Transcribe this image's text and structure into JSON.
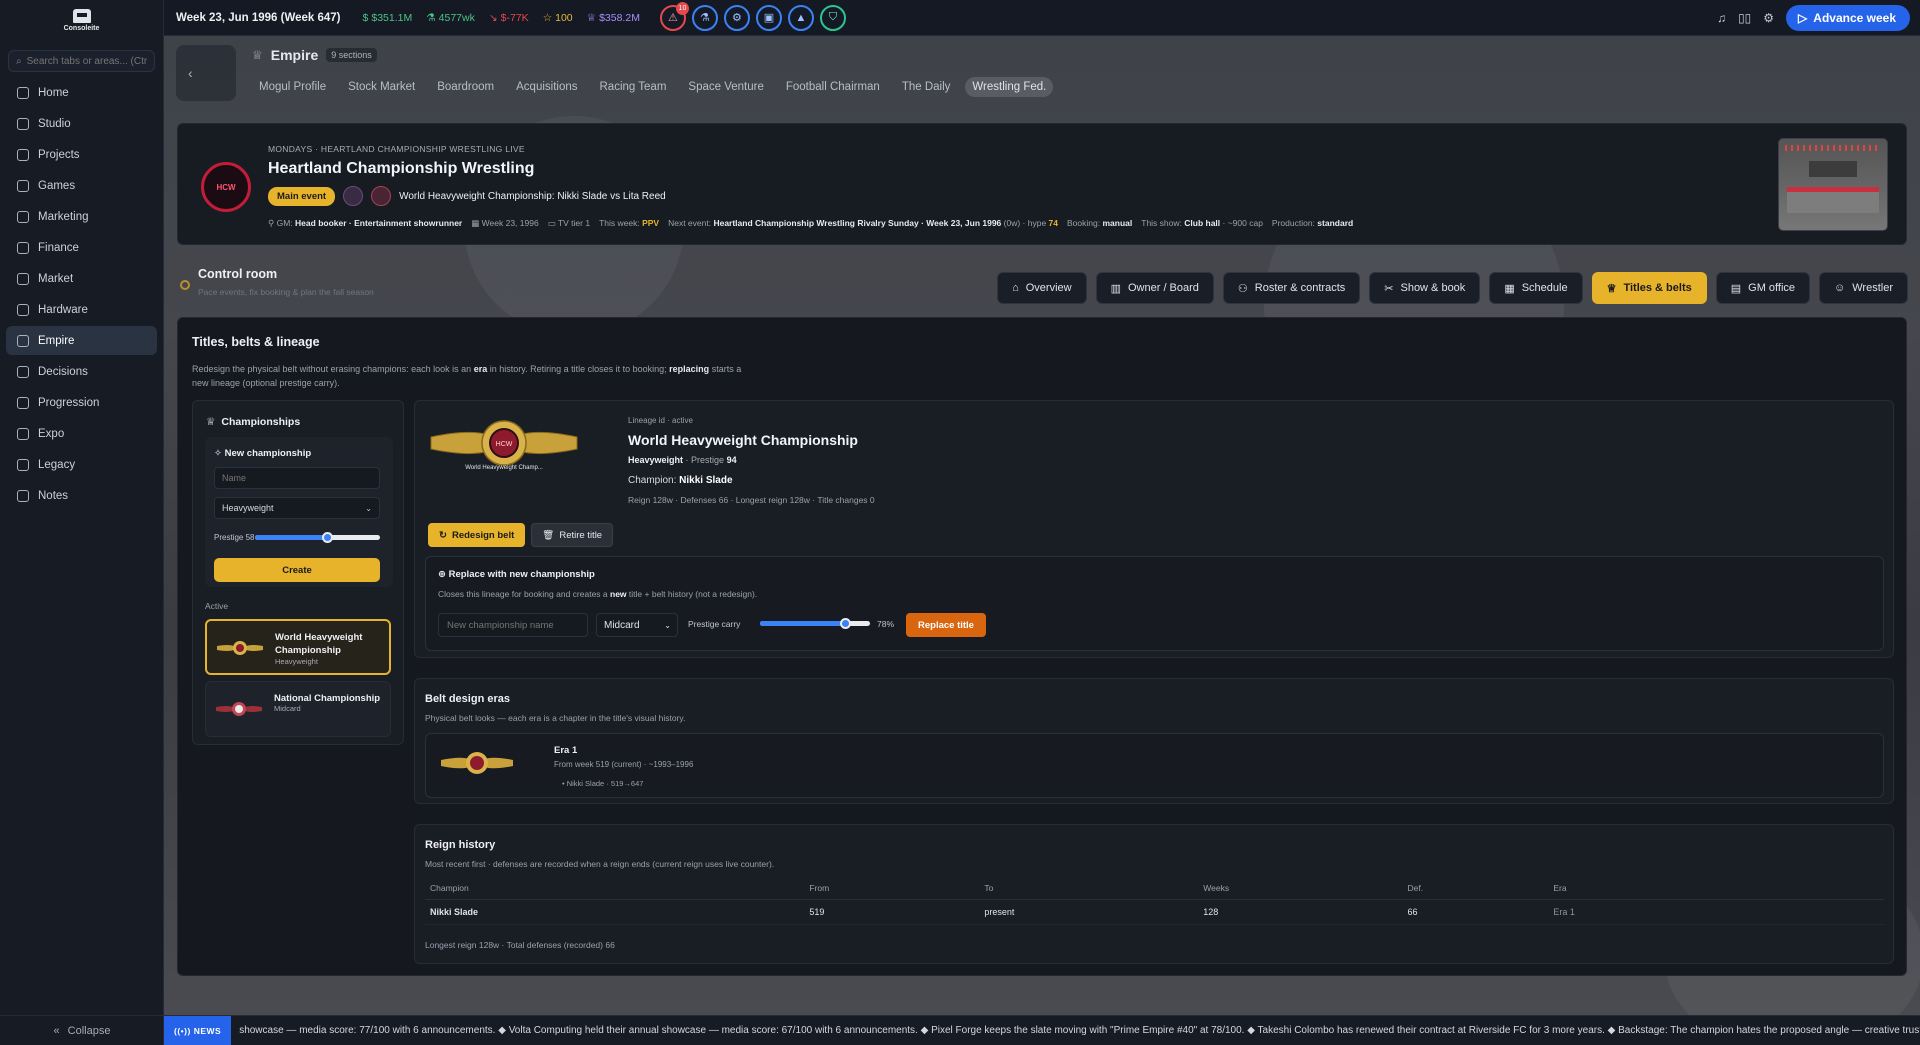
{
  "app": {
    "logo_text": "Consoleite"
  },
  "sidebar": {
    "search_placeholder": "Search tabs or areas... (Ctrl+K)",
    "items": [
      {
        "label": "Home",
        "icon": "grid-icon"
      },
      {
        "label": "Studio",
        "icon": "building-icon"
      },
      {
        "label": "Projects",
        "icon": "folder-icon"
      },
      {
        "label": "Games",
        "icon": "gamepad-icon"
      },
      {
        "label": "Marketing",
        "icon": "megaphone-icon"
      },
      {
        "label": "Finance",
        "icon": "bank-icon"
      },
      {
        "label": "Market",
        "icon": "globe-icon"
      },
      {
        "label": "Hardware",
        "icon": "chip-icon"
      },
      {
        "label": "Empire",
        "icon": "crown-icon",
        "active": true
      },
      {
        "label": "Decisions",
        "icon": "warning-icon"
      },
      {
        "label": "Progression",
        "icon": "flask-icon"
      },
      {
        "label": "Expo",
        "icon": "monitor-icon"
      },
      {
        "label": "Legacy",
        "icon": "book-icon"
      },
      {
        "label": "Notes",
        "icon": "note-icon"
      }
    ],
    "collapse_label": "Collapse"
  },
  "topbar": {
    "date": "Week 23, Jun 1996 (Week 647)",
    "cash": "$351.1M",
    "income": "4577wk",
    "trend": "$-77K",
    "fame": "100",
    "valuation": "$358.2M",
    "alert_count": "10",
    "advance_label": "Advance week"
  },
  "empire": {
    "title": "Empire",
    "sections": "9 sections",
    "tabs": [
      "Mogul Profile",
      "Stock Market",
      "Boardroom",
      "Acquisitions",
      "Racing Team",
      "Space Venture",
      "Football Chairman",
      "The Daily",
      "Wrestling Fed."
    ],
    "active_tab": "Wrestling Fed."
  },
  "banner": {
    "logo_text": "HCW",
    "kicker": "MONDAYS · HEARTLAND CHAMPIONSHIP WRESTLING LIVE",
    "title": "Heartland Championship Wrestling",
    "main_event_label": "Main event",
    "match": "World Heavyweight Championship: Nikki Slade vs Lita Reed",
    "gm_label": "GM:",
    "gm_value": "Head booker · Entertainment showrunner",
    "week": "Week 23, 1996",
    "tv": "TV tier 1",
    "this_week_label": "This week:",
    "this_week_value": "PPV",
    "next_event_label": "Next event:",
    "next_event_value": "Heartland Championship Wrestling Rivalry Sunday · Week 23, Jun 1996",
    "next_event_in": "(0w) · hype",
    "hype": "74",
    "booking_label": "Booking:",
    "booking_value": "manual",
    "show_label": "This show:",
    "show_value": "Club hall",
    "show_cap": "· ~900 cap",
    "production_label": "Production:",
    "production_value": "standard"
  },
  "control_room": {
    "title": "Control room",
    "subtitle": "Pace events, fix booking & plan the fall season",
    "tabs": [
      "Overview",
      "Owner / Board",
      "Roster & contracts",
      "Show & book",
      "Schedule",
      "Titles & belts",
      "GM office",
      "Wrestler"
    ],
    "active_tab": "Titles & belts"
  },
  "titles": {
    "heading": "Titles, belts & lineage",
    "desc_a": "Redesign the physical belt without erasing champions: each look is an",
    "desc_era": "era",
    "desc_b": "in history. Retiring a title closes it to booking;",
    "desc_replacing": "replacing",
    "desc_c": "starts a new lineage (optional prestige carry).",
    "championships_label": "Championships",
    "new_champ": {
      "heading": "New championship",
      "name_placeholder": "Name",
      "division": "Heavyweight",
      "prestige_label": "Prestige 58",
      "prestige": 0.58,
      "create_label": "Create"
    },
    "active_label": "Active",
    "list": [
      {
        "name": "World Heavyweight Championship",
        "division": "Heavyweight"
      },
      {
        "name": "National Championship",
        "division": "Midcard"
      }
    ],
    "detail": {
      "belt_text": "World Heavyweight Champ...",
      "belt_logo": "HCW",
      "lineage": "Lineage id · active",
      "title": "World Heavyweight Championship",
      "division": "Heavyweight",
      "prestige_label": "· Prestige",
      "prestige": "94",
      "champion_label": "Champion:",
      "champion": "Nikki Slade",
      "stats": "Reign 128w · Defenses 66 · Longest reign 128w · Title changes 0",
      "redesign_label": "Redesign belt",
      "retire_label": "Retire title"
    },
    "replace": {
      "heading": "Replace with new championship",
      "desc_a": "Closes this lineage for booking and creates a",
      "desc_new": "new",
      "desc_b": "title + belt history (not a redesign).",
      "name_placeholder": "New championship name",
      "division": "Midcard",
      "carry_label": "Prestige carry",
      "carry": 0.78,
      "carry_pct": "78%",
      "button": "Replace title"
    },
    "eras": {
      "heading": "Belt design eras",
      "desc": "Physical belt looks — each era is a chapter in the title's visual history.",
      "items": [
        {
          "name": "Era 1",
          "sub": "From week 519 (current) · ~1993–1996",
          "holder": "Nikki Slade · 519→647"
        }
      ]
    },
    "reigns": {
      "heading": "Reign history",
      "desc": "Most recent first · defenses are recorded when a reign ends (current reign uses live counter).",
      "columns": [
        "Champion",
        "From",
        "To",
        "Weeks",
        "Def.",
        "Era"
      ],
      "rows": [
        [
          "Nikki Slade",
          "519",
          "present",
          "128",
          "66",
          "Era 1"
        ]
      ],
      "footer": "Longest reign 128w · Total defenses (recorded) 66"
    }
  },
  "news": {
    "tag": "NEWS",
    "text": "showcase — media score: 77/100 with 6 announcements. ◆ Volta Computing held their annual showcase — media score: 67/100 with 6 announcements. ◆ Pixel Forge keeps the slate moving with \"Prime Empire #40\" at 78/100. ◆ Takeshi Colombo has renewed their contract at Riverside FC for 3 more years. ◆ Backstage: The champion hates the proposed angle — creative trust is fraying."
  },
  "colors": {
    "accent": "#e7b32b",
    "primary": "#2563eb",
    "danger": "#e5484d",
    "replace": "#d9650f"
  }
}
